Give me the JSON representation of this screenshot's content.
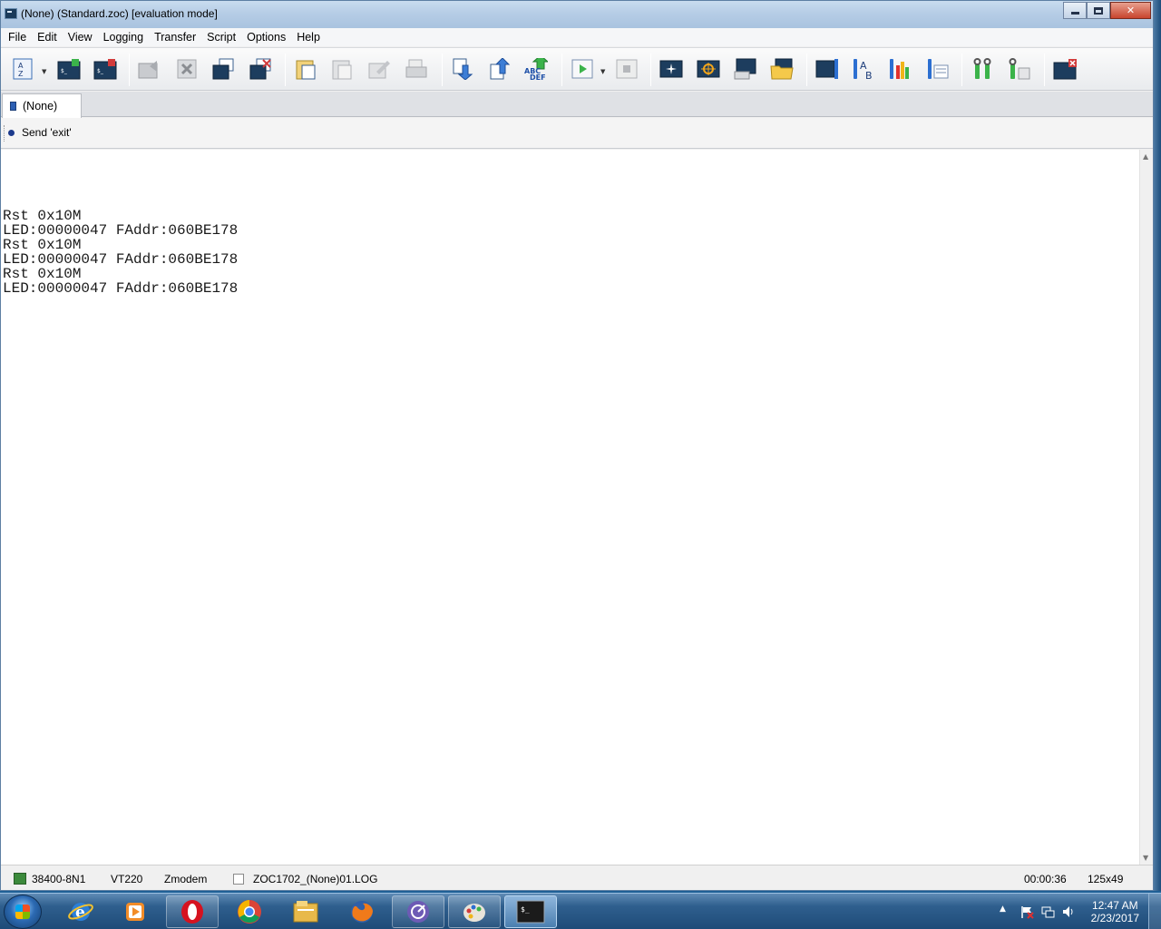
{
  "window": {
    "title": "(None) (Standard.zoc) [evaluation mode]"
  },
  "menu": [
    "File",
    "Edit",
    "View",
    "Logging",
    "Transfer",
    "Script",
    "Options",
    "Help"
  ],
  "toolbar": {
    "icons": [
      "sort-az-icon",
      "connect-icon",
      "disconnect-icon",
      "host-back-icon",
      "delete-icon",
      "session-copy-icon",
      "session-close-icon",
      "paste-icon",
      "paste-special-icon",
      "edit-icon",
      "print-icon",
      "download-icon",
      "upload-icon",
      "abc-def-icon",
      "run-script-icon",
      "stop-icon",
      "star-icon",
      "target-icon",
      "terminal-window-icon",
      "folder-icon",
      "session-settings-icon",
      "font-icon",
      "colors-icon",
      "options-icon",
      "tools-icon",
      "program-settings-icon",
      "exit-icon"
    ]
  },
  "tab": {
    "label": "(None)"
  },
  "buttonbar": {
    "send_exit": "Send 'exit'"
  },
  "terminal": {
    "lines": [
      "Rst 0x10M",
      "LED:00000047 FAddr:060BE178",
      "Rst 0x10M",
      "LED:00000047 FAddr:060BE178",
      "Rst 0x10M",
      "LED:00000047 FAddr:060BE178"
    ]
  },
  "status": {
    "serial": "38400-8N1",
    "emulation": "VT220",
    "transfer": "Zmodem",
    "logfile": "ZOC1702_(None)01.LOG",
    "elapsed": "00:00:36",
    "size": "125x49"
  },
  "taskbar": {
    "time": "12:47 AM",
    "date": "2/23/2017",
    "apps": [
      "internet-explorer-icon",
      "media-player-icon",
      "opera-icon",
      "chrome-icon",
      "file-explorer-icon",
      "firefox-icon",
      "bittorrent-icon",
      "paint-icon",
      "zoc-terminal-icon"
    ]
  },
  "colors": {
    "accent": "#2d5fb3",
    "taskbar": "#1e4b78"
  }
}
